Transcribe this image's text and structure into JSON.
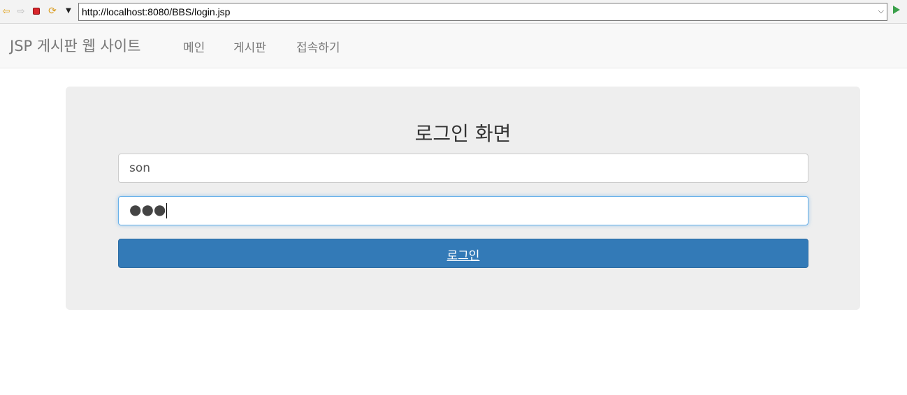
{
  "browser": {
    "url": "http://localhost:8080/BBS/login.jsp",
    "icons": [
      "back-arrow-icon",
      "forward-arrow-icon",
      "stop-icon",
      "refresh-icon",
      "menu-chevron-icon",
      "url-dropdown-icon",
      "go-icon"
    ]
  },
  "navbar": {
    "brand": "JSP 게시판 웹 사이트",
    "items": [
      {
        "label": "메인"
      },
      {
        "label": "게시판"
      },
      {
        "label": "접속하기"
      }
    ]
  },
  "login": {
    "title": "로그인 화면",
    "user_id_value": "son",
    "password_mask": "●●●",
    "submit_label": "로그인"
  },
  "colors": {
    "primary_button": "#337ab7",
    "panel_background": "#eeeeee",
    "focus_border": "#66afe9"
  }
}
